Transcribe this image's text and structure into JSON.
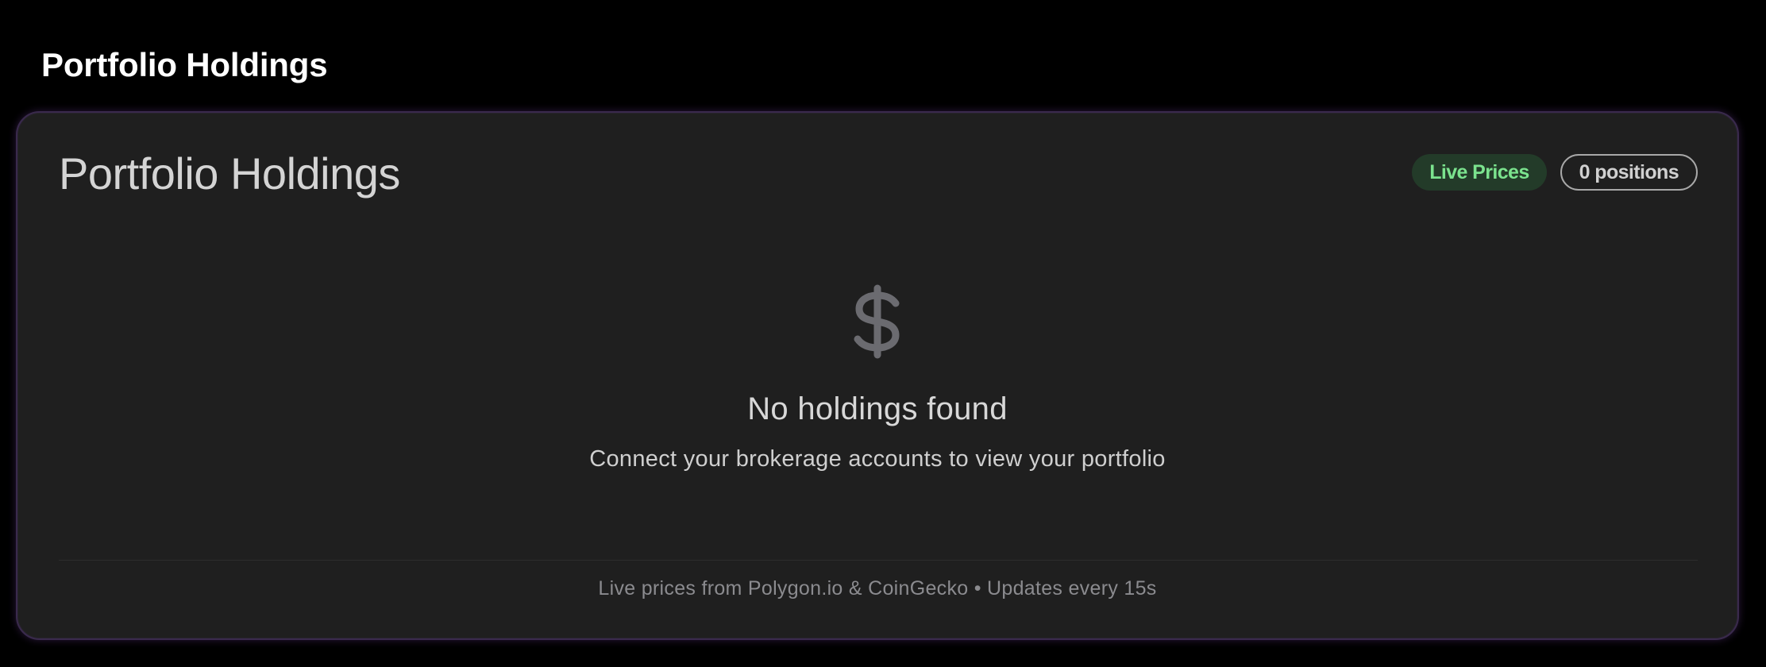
{
  "page": {
    "title": "Portfolio Holdings"
  },
  "card": {
    "title": "Portfolio Holdings",
    "badges": {
      "live_prices": "Live Prices",
      "positions": "0 positions"
    },
    "empty_state": {
      "icon": "dollar-icon",
      "title": "No holdings found",
      "subtitle": "Connect your brokerage accounts to view your portfolio"
    },
    "footer": "Live prices from Polygon.io & CoinGecko • Updates every 15s"
  },
  "colors": {
    "background": "#000000",
    "card_background": "#1f1f1f",
    "card_border": "#3a2a4d",
    "live_badge_bg": "#233b29",
    "live_badge_text": "#7be38e",
    "muted_text": "#8b8b8f"
  }
}
